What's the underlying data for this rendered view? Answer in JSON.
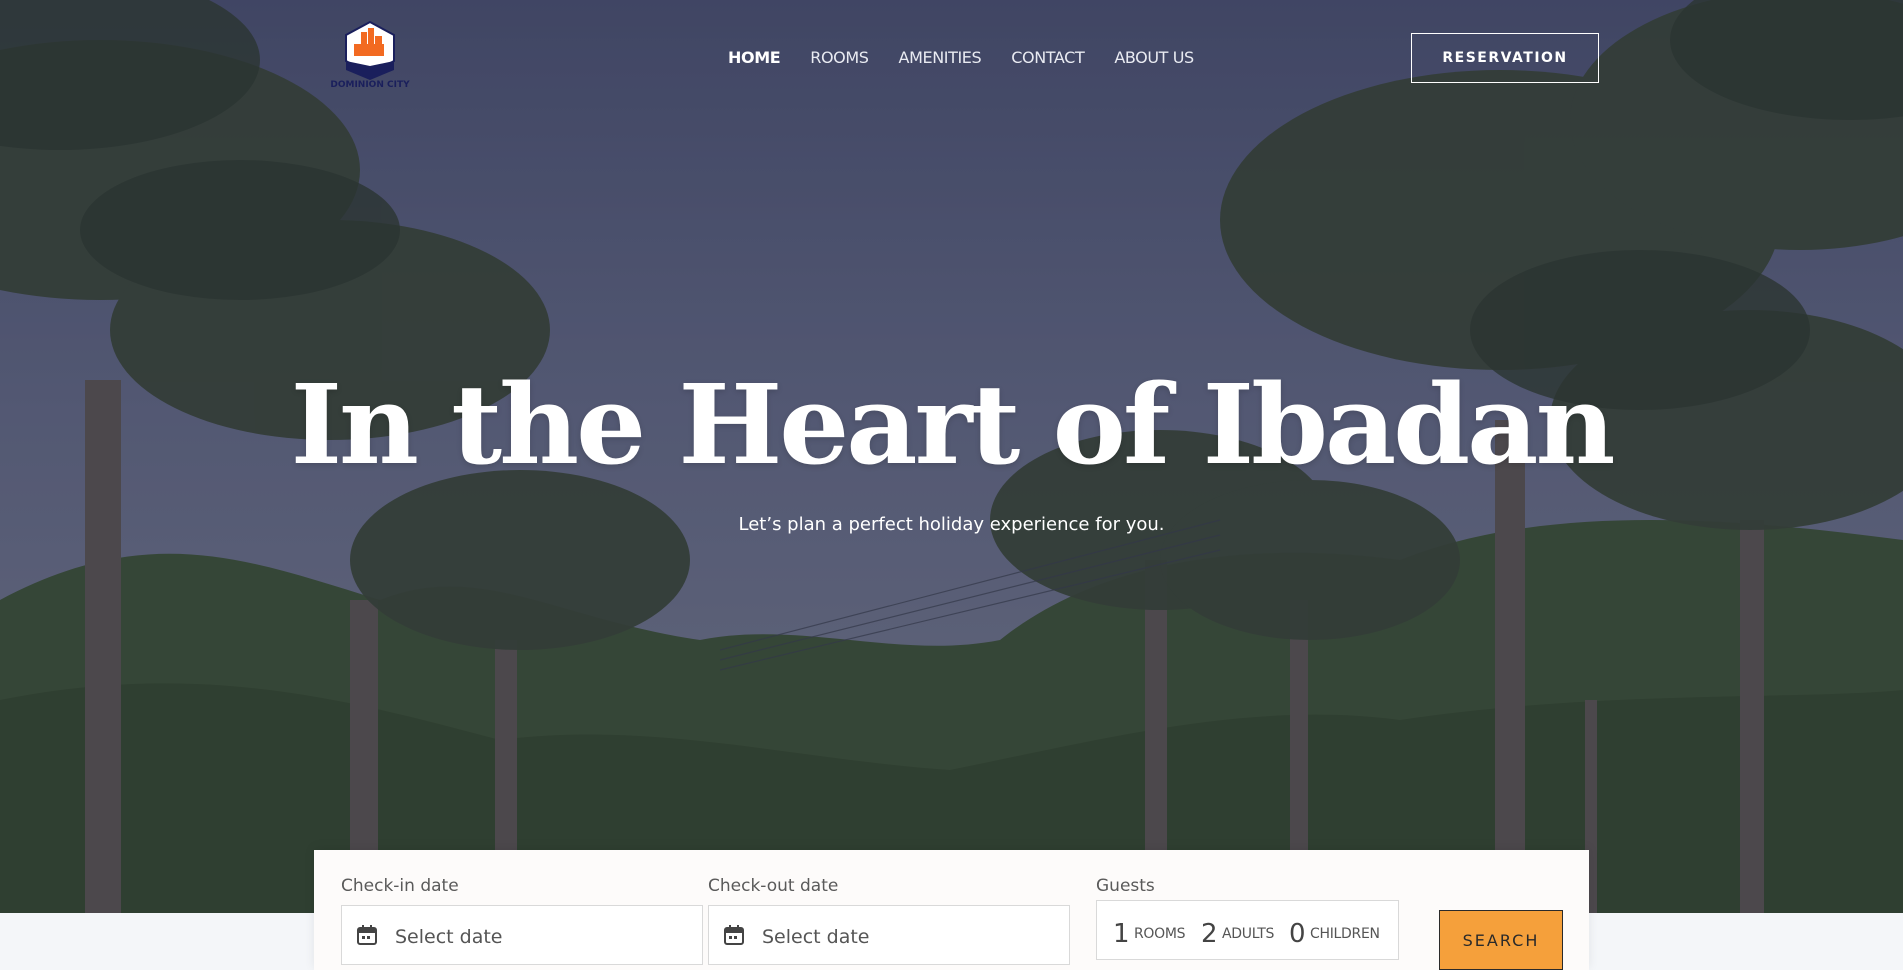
{
  "brand": {
    "logo_text": "DOMINION CITY",
    "accent": "#f5a03b",
    "logo_colors": [
      "#f26a21",
      "#1a1f5c"
    ]
  },
  "nav": {
    "items": [
      {
        "label": "HOME",
        "active": true
      },
      {
        "label": "ROOMS",
        "active": false
      },
      {
        "label": "AMENITIES",
        "active": false
      },
      {
        "label": "CONTACT",
        "active": false
      },
      {
        "label": "ABOUT US",
        "active": false
      }
    ],
    "reservation_label": "RESERVATION"
  },
  "hero": {
    "title": "In the Heart of Ibadan",
    "subtitle": "Let’s plan a perfect holiday experience for you."
  },
  "booking": {
    "checkin_label": "Check-in date",
    "checkin_placeholder": "Select date",
    "checkout_label": "Check-out date",
    "checkout_placeholder": "Select date",
    "guests_label": "Guests",
    "rooms_count": "1",
    "rooms_label": "ROOMS",
    "adults_count": "2",
    "adults_label": "ADULTS",
    "children_count": "0",
    "children_label": "CHILDREN",
    "search_label": "SEARCH",
    "calendar_icon": "calendar-icon"
  }
}
